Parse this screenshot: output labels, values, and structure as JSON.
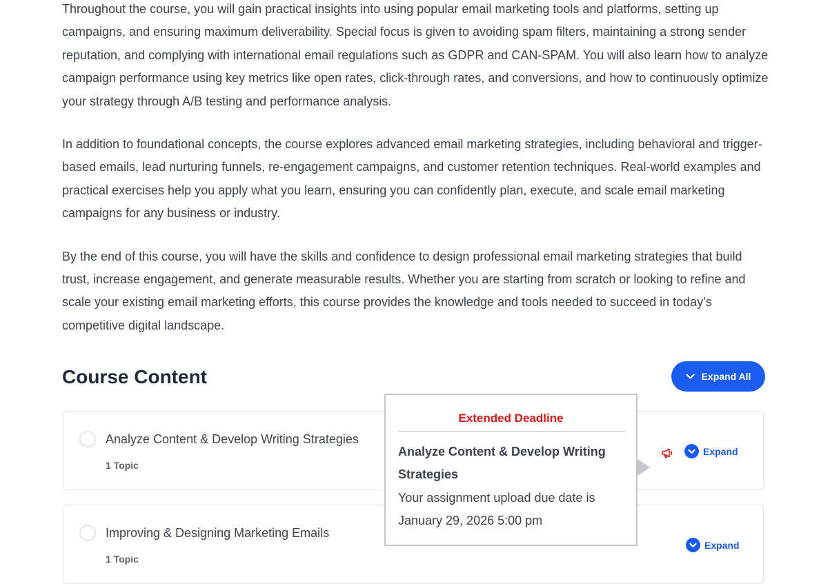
{
  "description": {
    "paragraphs": [
      "Throughout the course, you will gain practical insights into using popular email marketing tools and platforms, setting up campaigns, and ensuring maximum deliverability. Special focus is given to avoiding spam filters, maintaining a strong sender reputation, and complying with international email regulations such as GDPR and CAN-SPAM. You will also learn how to analyze campaign performance using key metrics like open rates, click-through rates, and conversions, and how to continuously optimize your strategy through A/B testing and performance analysis.",
      "In addition to foundational concepts, the course explores advanced email marketing strategies, including behavioral and trigger-based emails, lead nurturing funnels, re-engagement campaigns, and customer retention techniques. Real-world examples and practical exercises help you apply what you learn, ensuring you can confidently plan, execute, and scale email marketing campaigns for any business or industry.",
      "By the end of this course, you will have the skills and confidence to design professional email marketing strategies that build trust, increase engagement, and generate measurable results. Whether you are starting from scratch or looking to refine and scale your existing email marketing efforts, this course provides the knowledge and tools needed to succeed in today’s competitive digital landscape."
    ]
  },
  "course_content": {
    "title": "Course Content",
    "expand_all_label": "Expand All",
    "lessons": [
      {
        "title": "Analyze Content & Develop Writing Strategies",
        "topic_count": "1 Topic",
        "expand_label": "Expand",
        "has_deadline_icon": true
      },
      {
        "title": "Improving & Designing Marketing Emails",
        "topic_count": "1 Topic",
        "expand_label": "Expand",
        "has_deadline_icon": false
      }
    ]
  },
  "deadline_tooltip": {
    "heading": "Extended Deadline",
    "lesson_title": "Analyze Content & Develop Writing Strategies",
    "message": "Your assignment upload due date is January 29, 2026 5:00 pm"
  },
  "icons": {
    "expand_all": "chevron-down-icon",
    "expand": "chevron-down-circle-icon",
    "deadline": "megaphone-icon"
  },
  "colors": {
    "accent": "#1a5cf0",
    "deadline_red": "#d81818",
    "heading": "#1f2a3a",
    "body_text": "#3b4350"
  }
}
